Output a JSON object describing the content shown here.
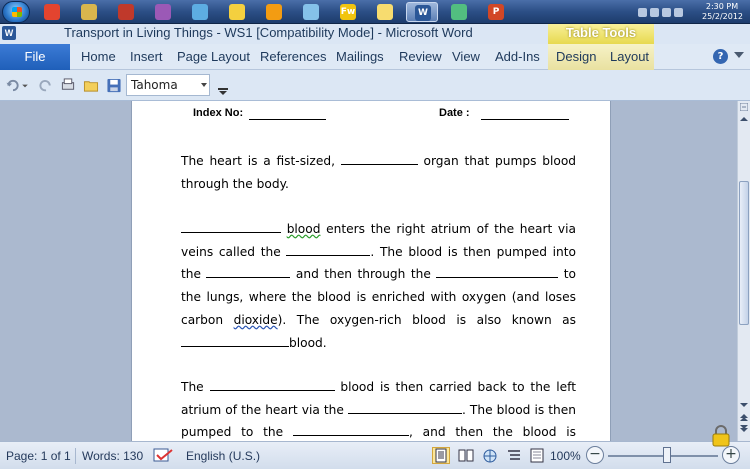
{
  "taskbar": {
    "apps": [
      {
        "name": "chrome-icon",
        "color": "#e3442f"
      },
      {
        "name": "folder-icon",
        "color": "#d9b64d"
      },
      {
        "name": "app-icon",
        "color": "#c0392b"
      },
      {
        "name": "paint-icon",
        "color": "#9b59b6"
      },
      {
        "name": "brush-icon",
        "color": "#5dade2"
      },
      {
        "name": "globe-icon",
        "color": "#f4d03f"
      },
      {
        "name": "vlc-icon",
        "color": "#f39c12"
      },
      {
        "name": "notepad-icon",
        "color": "#85c1e9"
      },
      {
        "name": "fireworks-icon",
        "color": "#f1c40f",
        "label": "Fw"
      },
      {
        "name": "folder-icon",
        "color": "#f7dc6f"
      },
      {
        "name": "word-icon",
        "color": "#2b5797",
        "label": "W"
      },
      {
        "name": "messenger-icon",
        "color": "#52be80"
      },
      {
        "name": "powerpoint-icon",
        "color": "#d24726",
        "label": "P"
      }
    ],
    "clock_time": "2:30 PM",
    "clock_date": "25/2/2012"
  },
  "titlebar": {
    "title": "Transport in Living Things - WS1 [Compatibility Mode] - Microsoft Word",
    "context_tab": "Table Tools"
  },
  "ribbon": {
    "file": "File",
    "tabs": [
      "Home",
      "Insert",
      "Page Layout",
      "References",
      "Mailings",
      "Review",
      "View",
      "Add-Ins",
      "Design",
      "Layout"
    ]
  },
  "qat": {
    "font": "Tahoma"
  },
  "document": {
    "index_label": "Index No:",
    "date_label": "Date :",
    "p1": {
      "a": "The heart is a fist-sized,",
      "b": "organ that pumps blood through the body."
    },
    "p2": {
      "a": "blood",
      "b": " enters the right atrium of the heart via veins called the ",
      "c": ". The blood is then pumped into the ",
      "d": " and then through the ",
      "e": " to the lungs, where the blood is enriched with oxygen (and loses carbon ",
      "f": "dioxide",
      "g": "). The oxygen-rich blood is also known as ",
      "h": "blood."
    },
    "p3": {
      "a": "The ",
      "b": " blood is then carried back to the left atrium of the heart via the ",
      "c": ". The blood is then pumped to the ",
      "d": ", and then the blood is pumped through the"
    }
  },
  "status": {
    "page": "Page: 1 of 1",
    "words": "Words: 130",
    "language": "English (U.S.)",
    "zoom": "100%",
    "zoom_minus": "−",
    "zoom_plus": "+"
  }
}
